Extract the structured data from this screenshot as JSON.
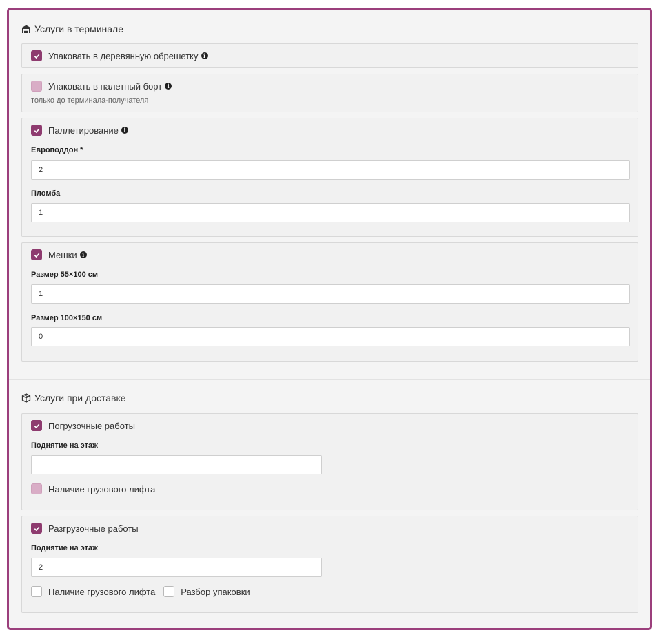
{
  "terminal_services": {
    "title": "Услуги в терминале",
    "wood_crate": {
      "label": "Упаковать в деревянную обрешетку",
      "checked": true
    },
    "pallet_board": {
      "label": "Упаковать в палетный борт",
      "checked": false,
      "hint": "только до терминала-получателя"
    },
    "palletizing": {
      "label": "Паллетирование",
      "checked": true,
      "europallet": {
        "label": "Европоддон",
        "required_mark": "*",
        "value": "2"
      },
      "seal": {
        "label": "Пломба",
        "value": "1"
      }
    },
    "bags": {
      "label": "Мешки",
      "checked": true,
      "size_small": {
        "label": "Размер 55×100 см",
        "value": "1"
      },
      "size_large": {
        "label": "Размер 100×150 см",
        "value": "0"
      }
    }
  },
  "delivery_services": {
    "title": "Услуги при доставке",
    "loading": {
      "label": "Погрузочные работы",
      "checked": true,
      "floor_lift": {
        "label": "Поднятие на этаж",
        "value": ""
      },
      "freight_elevator": {
        "label": "Наличие грузового лифта",
        "checked": false
      }
    },
    "unloading": {
      "label": "Разгрузочные работы",
      "checked": true,
      "floor_lift": {
        "label": "Поднятие на этаж",
        "value": "2"
      },
      "freight_elevator": {
        "label": "Наличие грузового лифта",
        "checked": false
      },
      "unpacking": {
        "label": "Разбор упаковки",
        "checked": false
      }
    }
  },
  "colors": {
    "accent": "#8e3b6f",
    "accent_disabled": "#d9adc6",
    "frame_border": "#9b3f7c"
  }
}
